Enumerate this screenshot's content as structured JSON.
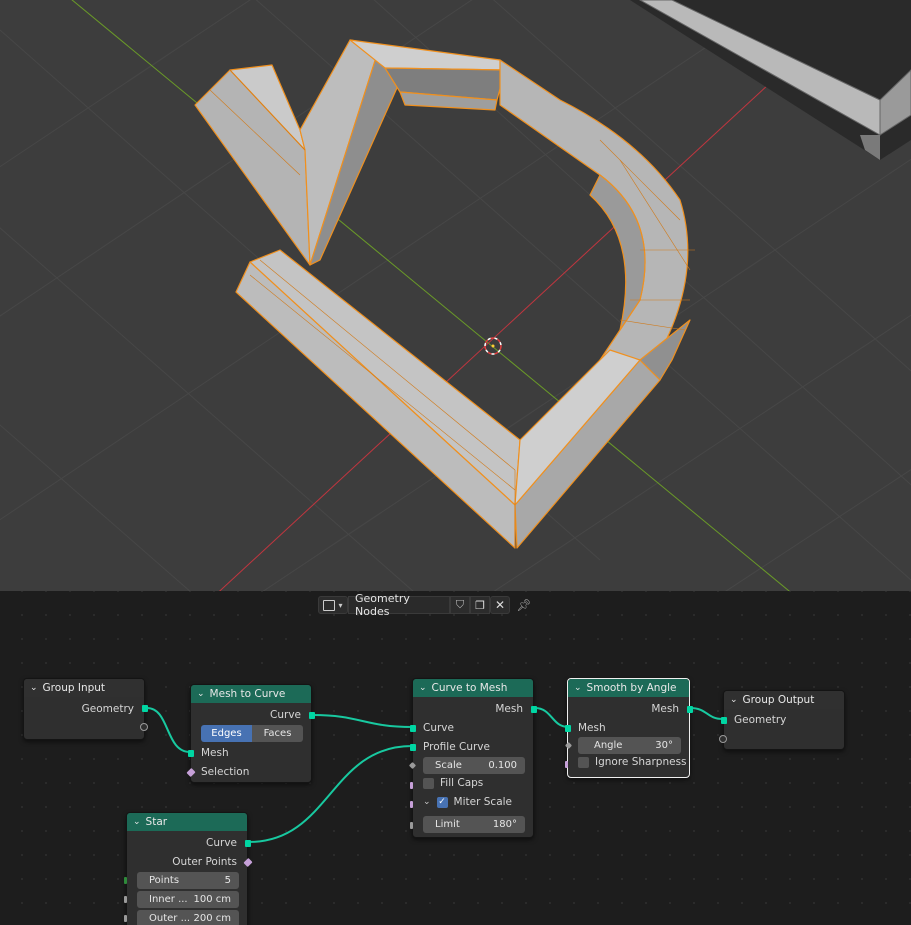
{
  "node_header": {
    "editor_type_icon": "node-editor-icon",
    "tree_name": "Geometry Nodes",
    "fake_user_icon": "shield-icon",
    "duplicate_icon": "duplicate-icon",
    "unlink_icon": "close-icon",
    "pin_icon": "pin-icon"
  },
  "nodes": {
    "group_input": {
      "title": "Group Input",
      "out_geometry": "Geometry"
    },
    "mesh_to_curve": {
      "title": "Mesh to Curve",
      "out_curve": "Curve",
      "mode_edges": "Edges",
      "mode_faces": "Faces",
      "in_mesh": "Mesh",
      "in_selection": "Selection"
    },
    "curve_to_mesh": {
      "title": "Curve to Mesh",
      "out_mesh": "Mesh",
      "in_curve": "Curve",
      "in_profile": "Profile Curve",
      "scale_label": "Scale",
      "scale_value": "0.100",
      "fill_caps": "Fill Caps",
      "fill_caps_checked": false,
      "miter_scale": "Miter Scale",
      "miter_scale_checked": true,
      "limit_label": "Limit",
      "limit_value": "180°"
    },
    "smooth_by_angle": {
      "title": "Smooth by Angle",
      "out_mesh": "Mesh",
      "in_mesh": "Mesh",
      "angle_label": "Angle",
      "angle_value": "30°",
      "ignore_sharpness": "Ignore Sharpness",
      "ignore_sharpness_checked": false
    },
    "group_output": {
      "title": "Group Output",
      "in_geometry": "Geometry"
    },
    "star": {
      "title": "Star",
      "out_curve": "Curve",
      "out_outer_points": "Outer Points",
      "points_label": "Points",
      "points_value": "5",
      "inner_label": "Inner ...",
      "inner_value": "100 cm",
      "outer_label": "Outer ...",
      "outer_value": "200 cm"
    }
  },
  "colors": {
    "geometry_header": "#1c6a57",
    "geometry_socket": "#00d6a3",
    "selection_orange": "#f0901e",
    "viewport_bg": "#3d3d3d",
    "x_axis": "#c0363f",
    "y_axis": "#6a9a28"
  }
}
